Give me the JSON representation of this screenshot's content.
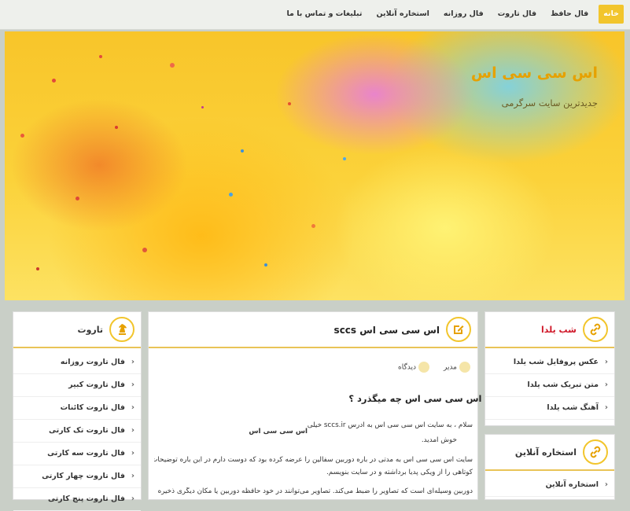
{
  "nav": {
    "items": [
      {
        "label": "خانه",
        "active": true
      },
      {
        "label": "فال حافظ",
        "active": false
      },
      {
        "label": "فال تاروت",
        "active": false
      },
      {
        "label": "فال روزانه",
        "active": false
      },
      {
        "label": "استخاره آنلاین",
        "active": false
      },
      {
        "label": "تبلیغات و تماس با ما",
        "active": false
      }
    ]
  },
  "hero": {
    "title": "اس سی سی اس",
    "subtitle": "جدیدترین سایت سرگرمی"
  },
  "tarot_widget": {
    "title": "تاروت",
    "items": [
      "فال تاروت روزانه",
      "فال تاروت کبیر",
      "فال تاروت کائنات",
      "فال تاروت تک کارتی",
      "فال تاروت سه کارتی",
      "فال تاروت چهار کارتی",
      "فال تاروت پنج کارتی"
    ]
  },
  "post": {
    "title": "اس سی سی اس sccs",
    "author": "مدیر",
    "comments": "دیدگاه",
    "heading": "در اس سی سی اس چه میگذرد ؟",
    "paragraph_lines": [
      "سلام ، به سایت اس سی سی اس به آدرس sccs.ir خیلی",
      "اس سی سی اس",
      "خوش آمدید.",
      "سایت اس سی سی اس به مدتی در باره دوربین سفالین را عرضه کرده بود که دوست دارم در این باره توضیحات",
      "کوتاهی را از ویکی پدیا برداشته و در سایت بنویسم.",
      "دوربین وسیله‌ای است که تصاویر را ضبط می‌کند. تصاویر می‌توانند در خود حافظه دوربین یا مکان دیگری ذخیره"
    ]
  },
  "yalda_widget": {
    "title": "شب یلدا",
    "items": [
      "عکس پروفایل شب یلدا",
      "متن تبریک شب یلدا",
      "آهنگ شب یلدا"
    ]
  },
  "istikhara_widget": {
    "title": "استخاره آنلاین",
    "items": [
      "استخاره آنلاین"
    ]
  },
  "colors": {
    "accent": "#f2c52c",
    "yalda_title": "#d0192a",
    "hero_title": "#e6a100"
  }
}
